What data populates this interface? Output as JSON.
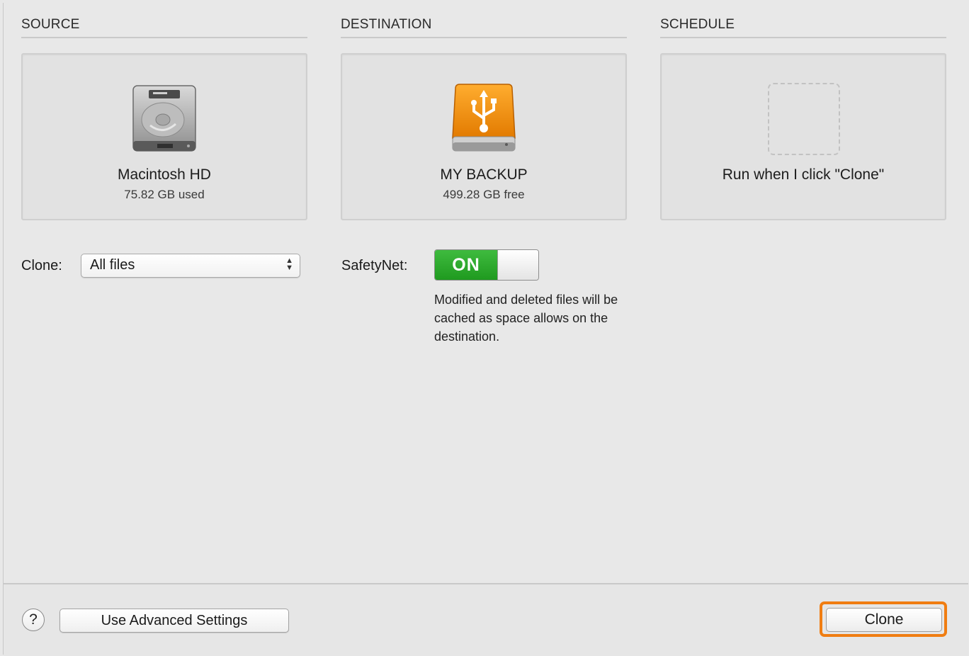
{
  "source": {
    "header": "SOURCE",
    "name": "Macintosh HD",
    "detail": "75.82 GB used",
    "icon": "hard-drive-icon"
  },
  "destination": {
    "header": "DESTINATION",
    "name": "MY BACKUP",
    "detail": "499.28 GB free",
    "icon": "usb-drive-icon"
  },
  "schedule": {
    "header": "SCHEDULE",
    "text": "Run when I click \"Clone\""
  },
  "clone_options": {
    "label": "Clone:",
    "selected": "All files"
  },
  "safetynet": {
    "label": "SafetyNet:",
    "state": "ON",
    "description": "Modified and deleted files will be cached as space allows on the destination.",
    "on_color": "#2aa52a"
  },
  "footer": {
    "help_label": "?",
    "advanced_label": "Use Advanced Settings",
    "clone_label": "Clone",
    "highlight_color": "#f07d12"
  }
}
